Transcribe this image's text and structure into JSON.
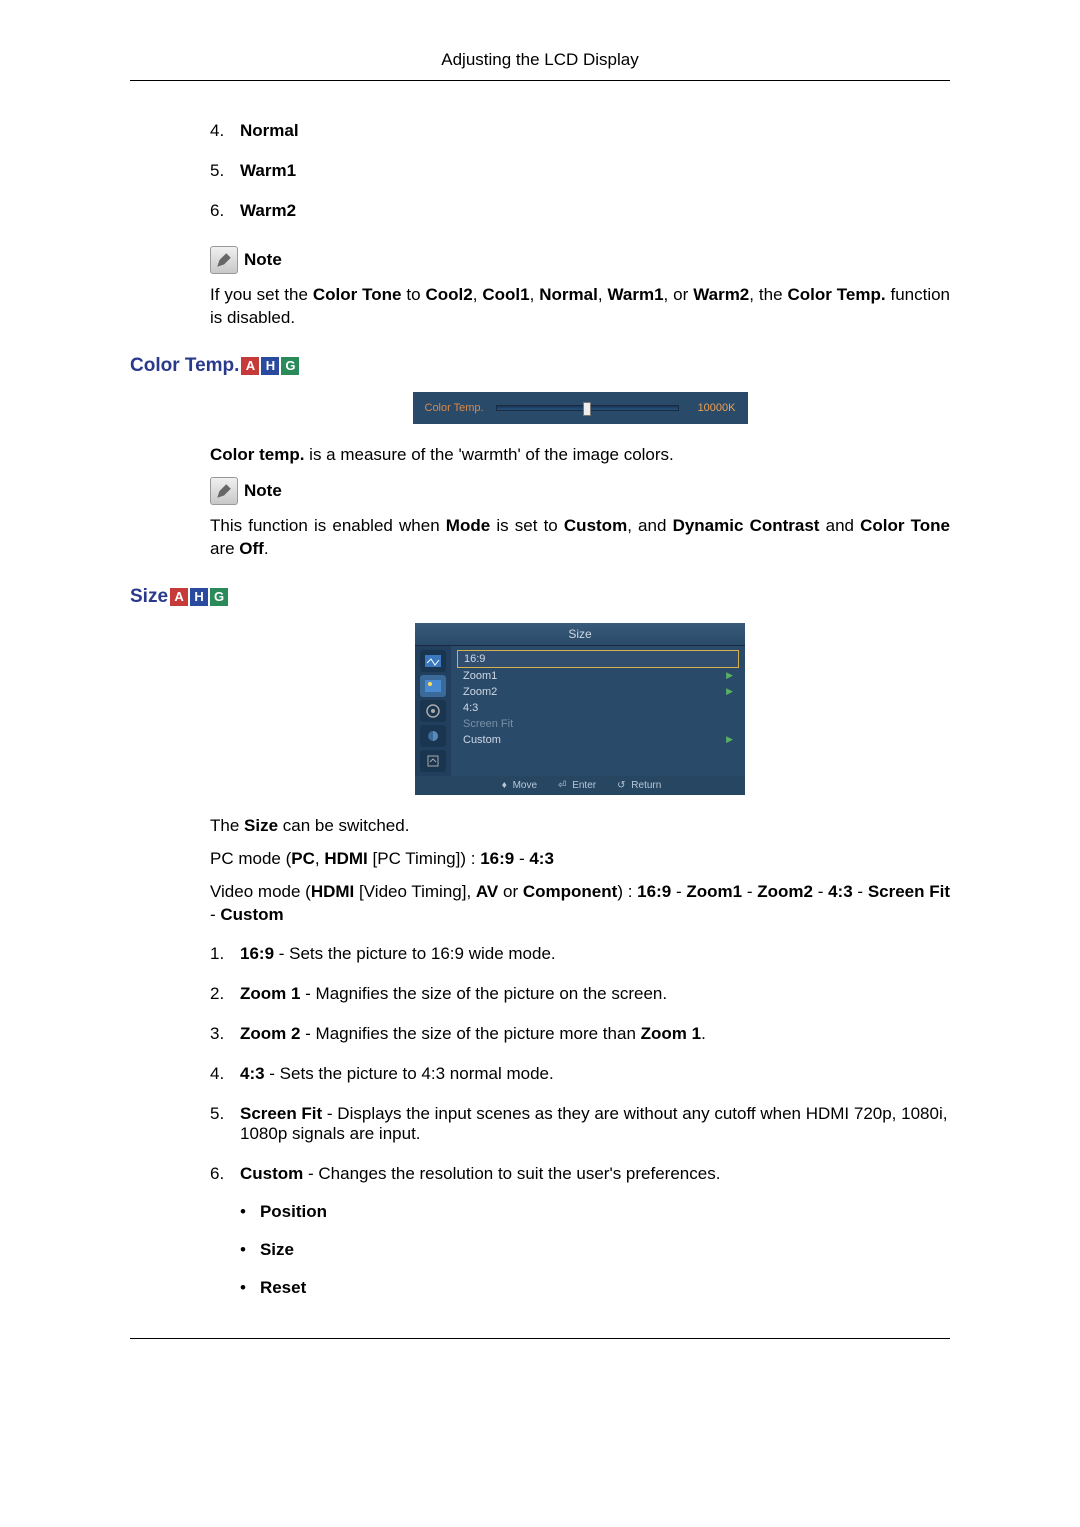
{
  "header": {
    "title": "Adjusting the LCD Display"
  },
  "toneList": {
    "items": [
      {
        "num": "4.",
        "label": "Normal"
      },
      {
        "num": "5.",
        "label": "Warm1"
      },
      {
        "num": "6.",
        "label": "Warm2"
      }
    ]
  },
  "note1": {
    "label": "Note",
    "text_pre": "If you set the ",
    "ct_bold": "Color Tone",
    "text_mid": " to ",
    "opts": [
      "Cool2",
      "Cool1",
      "Normal",
      "Warm1",
      "Warm2"
    ],
    "text_or": ", or ",
    "text_the": ", the ",
    "ctemp_bold": "Color Temp.",
    "text_end": " function is disabled."
  },
  "colorTemp": {
    "heading": "Color Temp.",
    "figLabel": "Color Temp.",
    "figValue": "10000K",
    "desc_pre": "Color temp.",
    "desc_rest": " is a measure of the 'warmth' of the image colors.",
    "note2Label": "Note",
    "note2": {
      "p1": "This function is enabled when ",
      "mode": "Mode",
      "p2": " is set to ",
      "custom": "Custom",
      "p3": ", and ",
      "dc": "Dynamic Contrast",
      "p4": " and ",
      "ctone": "Color Tone",
      "p5": " are ",
      "off": "Off",
      "p6": "."
    }
  },
  "size": {
    "heading": "Size",
    "menu": {
      "title": "Size",
      "items": [
        {
          "label": "16:9",
          "selected": true,
          "arrow": false
        },
        {
          "label": "Zoom1",
          "arrow": true
        },
        {
          "label": "Zoom2",
          "arrow": true
        },
        {
          "label": "4:3",
          "arrow": false
        },
        {
          "label": "Screen Fit",
          "dim": true,
          "arrow": false
        },
        {
          "label": "Custom",
          "arrow": true
        }
      ],
      "foot": {
        "move": "Move",
        "enter": "Enter",
        "ret": "Return"
      }
    },
    "intro_pre": "The ",
    "intro_bold": "Size",
    "intro_post": " can be switched.",
    "pcmode": {
      "t1": "PC mode (",
      "pc": "PC",
      "t2": ", ",
      "hdmi": "HDMI",
      "t3": " [PC Timing]) : ",
      "r169": "16:9",
      "dash": " - ",
      "r43": "4:3"
    },
    "videomode": {
      "t1": "Video mode (",
      "hdmi": "HDMI",
      "t2": " [Video Timing], ",
      "av": "AV",
      "t3": " or ",
      "comp": "Component",
      "t4": ") : ",
      "opts": [
        "16:9",
        "Zoom1",
        "Zoom2",
        "4:3",
        "Screen Fit",
        "Custom"
      ],
      "dash": " - "
    },
    "list": [
      {
        "num": "1.",
        "bold": "16:9",
        "text": " - Sets the picture to 16:9 wide mode."
      },
      {
        "num": "2.",
        "bold": "Zoom 1",
        "text": " - Magnifies the size of the picture on the screen."
      },
      {
        "num": "3.",
        "bold": "Zoom 2",
        "text": " - Magnifies the size of the picture more than ",
        "bold2": "Zoom 1",
        "tail": "."
      },
      {
        "num": "4.",
        "bold": "4:3",
        "text": " - Sets the picture to 4:3 normal mode."
      },
      {
        "num": "5.",
        "bold": "Screen Fit",
        "text": " - Displays the input scenes as they are without any cutoff when HDMI 720p, 1080i, 1080p signals are input."
      },
      {
        "num": "6.",
        "bold": "Custom",
        "text": " - Changes the resolution to suit the user's preferences."
      }
    ],
    "customSub": [
      "Position",
      "Size",
      "Reset"
    ]
  }
}
